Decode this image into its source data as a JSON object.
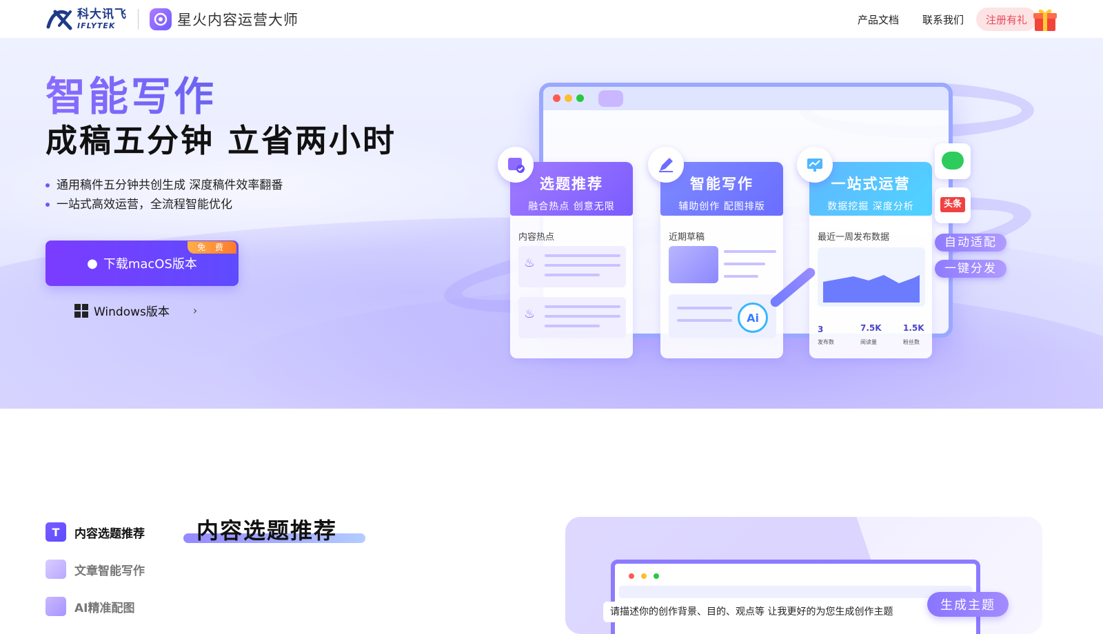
{
  "header": {
    "brand_cn": "科大讯飞",
    "brand_en": "IFLYTEK",
    "product_name": "星火内容运营大师",
    "nav": [
      {
        "label": "产品文档"
      },
      {
        "label": "联系我们"
      }
    ],
    "register_label": "注册有礼"
  },
  "hero": {
    "title": "智能写作",
    "subtitle": "成稿五分钟 立省两小时",
    "bullets": [
      "通用稿件五分钟共创生成 深度稿件效率翻番",
      "一站式高效运营，全流程智能优化"
    ],
    "mac_button": "下载macOS版本",
    "free_badge": "免 费",
    "windows_link": "Windows版本",
    "illustration": {
      "cards": [
        {
          "title": "选题推荐",
          "desc": "融合热点 创意无限",
          "label": "内容热点"
        },
        {
          "title": "智能写作",
          "desc": "辅助创作 配图排版",
          "label": "近期草稿"
        },
        {
          "title": "一站式运营",
          "desc": "数据挖掘 深度分析",
          "label": "最近一周发布数据"
        }
      ],
      "stats": [
        {
          "value": "3",
          "label": "发布数"
        },
        {
          "value": "7.5K",
          "label": "阅读量"
        },
        {
          "value": "1.5K",
          "label": "粉丝数"
        }
      ],
      "ai_badge": "Ai",
      "toutiao_label": "头条",
      "chips": [
        "自动适配",
        "一键分发"
      ]
    }
  },
  "features": {
    "items": [
      {
        "label": "内容选题推荐",
        "active": true
      },
      {
        "label": "文章智能写作",
        "active": false
      },
      {
        "label": "AI精准配图",
        "active": false
      }
    ],
    "section_title": "内容选题推荐",
    "demo": {
      "input_text": "请描述你的创作背景、目的、观点等 让我更好的为您生成创作主题",
      "generate_label": "生成主题"
    }
  },
  "colors": {
    "primary": "#6b4bff",
    "brand_blue": "#1f3a8a",
    "register_bg": "#fde3e3",
    "register_text": "#e9485c",
    "badge_orange": "#ff8a30"
  }
}
